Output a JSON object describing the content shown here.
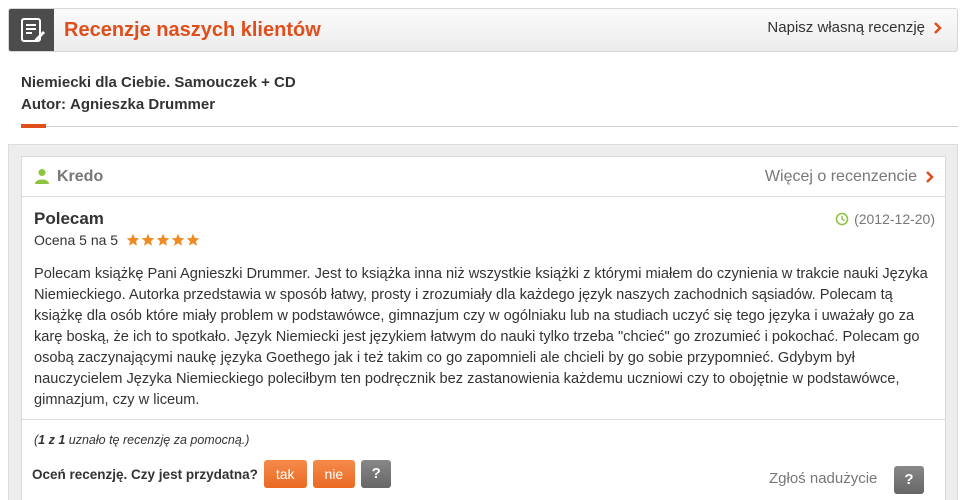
{
  "header": {
    "icon": "review-list-icon",
    "title": "Recenzje naszych klientów",
    "write_link": "Napisz własną recenzję",
    "accent_color": "#e04e1b"
  },
  "book": {
    "title": "Niemiecki dla Ciebie. Samouczek + CD",
    "author_label": "Autor:",
    "author_name": "Agnieszka Drummer"
  },
  "review": {
    "reviewer_icon": "user-icon",
    "reviewer": "Kredo",
    "more_link": "Więcej o recenzencie",
    "title": "Polecam",
    "date": "(2012-12-20)",
    "rating_text": "Ocena 5 na 5",
    "rating_value": 5,
    "rating_max": 5,
    "body": "Polecam książkę Pani Agnieszki Drummer. Jest to książka inna niż wszystkie książki z którymi miałem do czynienia w trakcie nauki Języka Niemieckiego. Autorka przedstawia w sposób łatwy, prosty i zrozumiały dla każdego język naszych zachodnich sąsiadów. Polecam tą książkę dla osób które miały problem w podstawówce, gimnazjum czy w ogólniaku lub na studiach uczyć się tego języka i uważały go za karę boską, że ich to spotkało. Język Niemiecki jest językiem łatwym do nauki tylko trzeba \"chcieć\" go zrozumieć i pokochać. Polecam go osobą zaczynającymi naukę języka Goethego jak i też takim co go zapomnieli ale chcieli by go sobie przypomnieć. Gdybym był nauczycielem Języka Niemieckiego poleciłbym ten podręcznik bez zastanowienia każdemu uczniowi czy to obojętnie w podstawówce, gimnazjum, czy w liceum.",
    "helpful_open": "(",
    "helpful_a": "1",
    "helpful_z": "z",
    "helpful_b": "1",
    "helpful_rest": "uznało tę recenzję za pomocną.)"
  },
  "actions": {
    "rate_label": "Oceń recenzję. Czy jest przydatna?",
    "yes": "tak",
    "no": "nie",
    "help": "?",
    "report": "Zgłoś nadużycie",
    "report_help": "?"
  }
}
